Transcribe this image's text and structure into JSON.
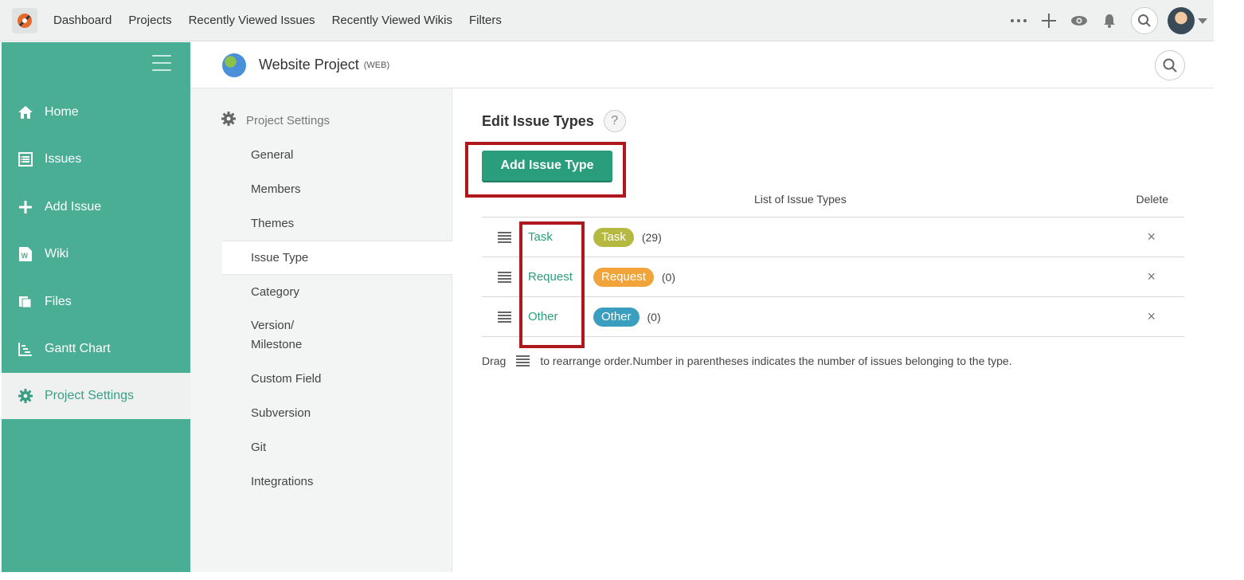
{
  "topnav": {
    "items": [
      "Dashboard",
      "Projects",
      "Recently Viewed Issues",
      "Recently Viewed Wikis",
      "Filters"
    ]
  },
  "topicons": [
    "more-icon",
    "plus-icon",
    "eye-icon",
    "bell-icon",
    "search-icon",
    "avatar",
    "chevron-down-icon"
  ],
  "sidebar": {
    "items": [
      {
        "label": "Home",
        "icon": "home-icon"
      },
      {
        "label": "Issues",
        "icon": "list-icon"
      },
      {
        "label": "Add Issue",
        "icon": "plus-icon"
      },
      {
        "label": "Wiki",
        "icon": "wiki-icon"
      },
      {
        "label": "Files",
        "icon": "files-icon"
      },
      {
        "label": "Gantt Chart",
        "icon": "gantt-icon"
      },
      {
        "label": "Project Settings",
        "icon": "gear-icon",
        "active": true
      }
    ]
  },
  "project": {
    "name": "Website Project",
    "key": "(WEB)"
  },
  "submenu": {
    "title": "Project Settings",
    "items": [
      "General",
      "Members",
      "Themes",
      "Issue Type",
      "Category",
      "Version/",
      "Milestone",
      "Custom Field",
      "Subversion",
      "Git",
      "Integrations"
    ],
    "active": "Issue Type"
  },
  "main": {
    "title": "Edit Issue Types",
    "help": "?",
    "add_button": "Add Issue Type",
    "col_list": "List of Issue Types",
    "col_delete": "Delete",
    "rows": [
      {
        "name": "Task",
        "badge": "Task",
        "count": "(29)",
        "color": "#b5b942"
      },
      {
        "name": "Request",
        "badge": "Request",
        "count": "(0)",
        "color": "#f0a43a"
      },
      {
        "name": "Other",
        "badge": "Other",
        "count": "(0)",
        "color": "#3a9ebf"
      }
    ],
    "delete_glyph": "×",
    "note_prefix": "Drag",
    "note_suffix": "to rearrange order.Number in parentheses indicates the number of issues belonging to the type."
  },
  "colors": {
    "sidebar": "#4aae95",
    "accent": "#2a9d7c",
    "highlight_box": "#b0181d"
  }
}
